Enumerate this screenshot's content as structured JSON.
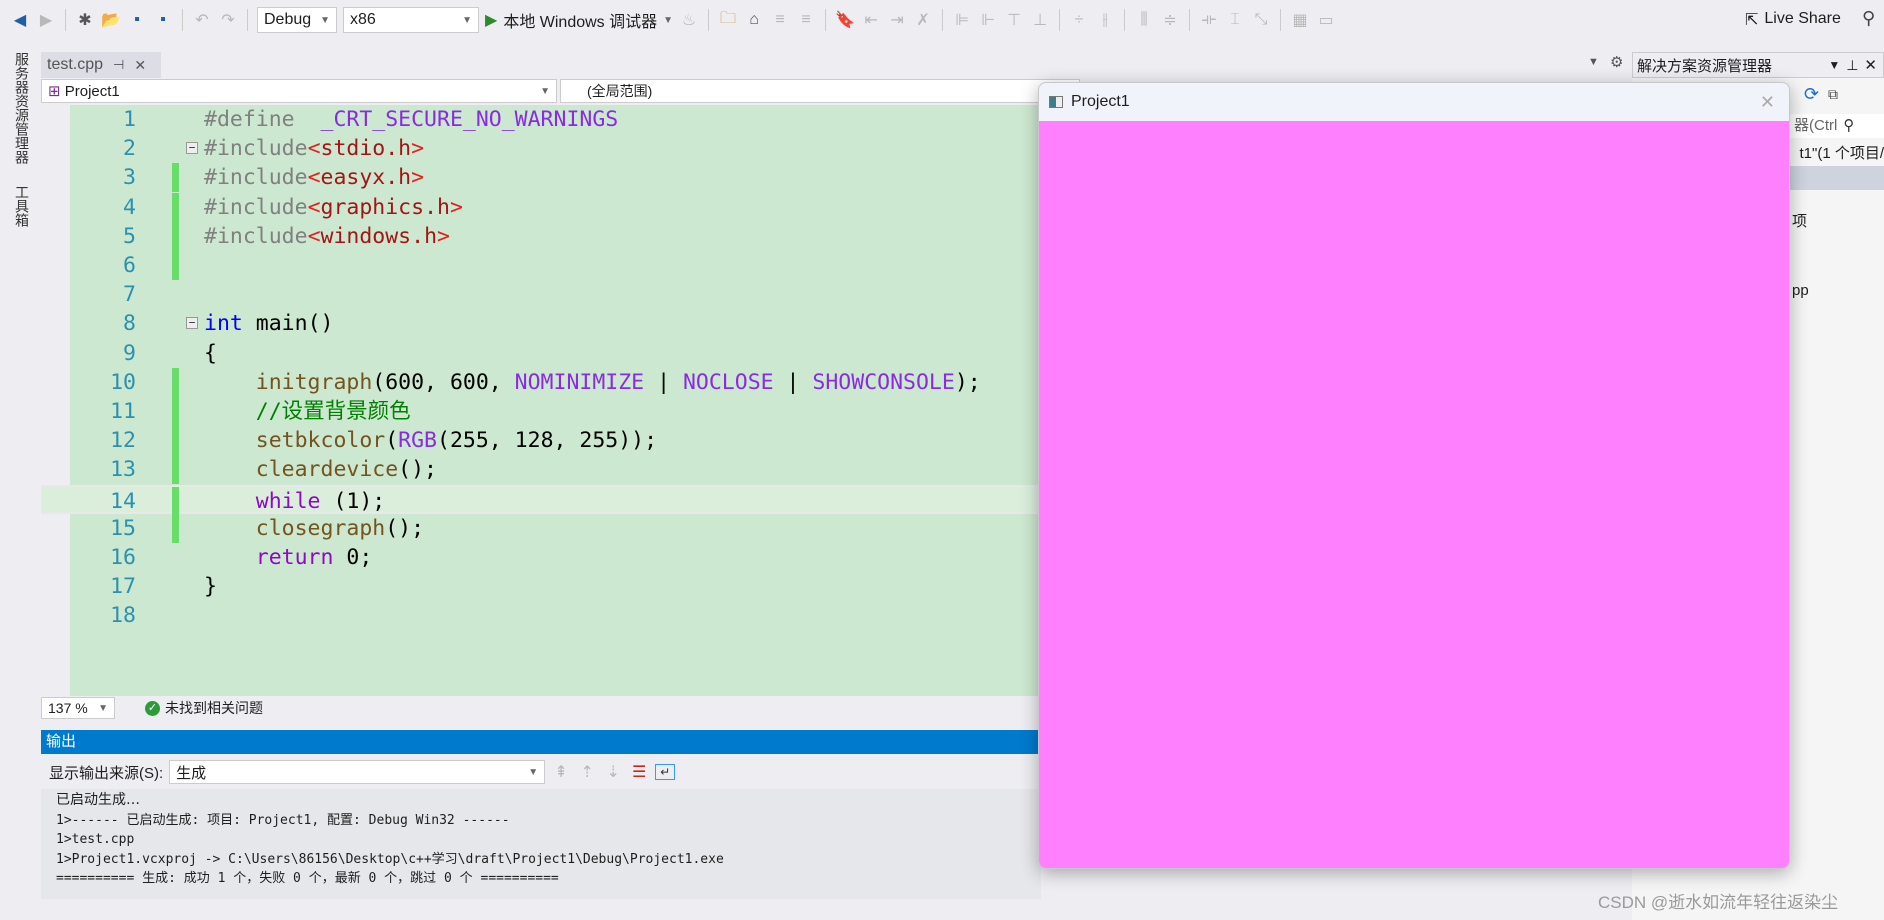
{
  "toolbar": {
    "config": "Debug",
    "platform": "x86",
    "run_label": "本地 Windows 调试器",
    "live_share": "Live Share"
  },
  "left_strip": {
    "tabs": [
      "服务器资源管理器",
      "工具箱"
    ]
  },
  "editor_tab": {
    "label": "test.cpp",
    "pin": "⊣",
    "close": "✕"
  },
  "navbar": {
    "project": "Project1",
    "scope": "(全局范围)"
  },
  "code": {
    "lines": [
      {
        "n": "1",
        "tokens": [
          [
            "#define  ",
            "pp"
          ],
          [
            "_CRT_SECURE_NO_WARNINGS",
            "mac"
          ]
        ]
      },
      {
        "n": "2",
        "fold": "−",
        "tokens": [
          [
            "#include",
            "pp"
          ],
          [
            "<",
            "br"
          ],
          [
            "stdio.h",
            "str"
          ],
          [
            ">",
            "br"
          ]
        ]
      },
      {
        "n": "3",
        "chg": true,
        "tokens": [
          [
            "#include",
            "pp"
          ],
          [
            "<",
            "br"
          ],
          [
            "easyx.h",
            "str"
          ],
          [
            ">",
            "br"
          ]
        ]
      },
      {
        "n": "4",
        "chg": true,
        "tokens": [
          [
            "#include",
            "pp"
          ],
          [
            "<",
            "br"
          ],
          [
            "graphics.h",
            "str"
          ],
          [
            ">",
            "br"
          ]
        ]
      },
      {
        "n": "5",
        "chg": true,
        "tokens": [
          [
            "#include",
            "pp"
          ],
          [
            "<",
            "br"
          ],
          [
            "windows.h",
            "str"
          ],
          [
            ">",
            "br"
          ]
        ]
      },
      {
        "n": "6",
        "chg": true,
        "tokens": []
      },
      {
        "n": "7",
        "tokens": []
      },
      {
        "n": "8",
        "fold": "−",
        "tokens": [
          [
            "int",
            "kwb"
          ],
          [
            " main()",
            "pl"
          ]
        ]
      },
      {
        "n": "9",
        "tokens": [
          [
            "{",
            "pl"
          ]
        ]
      },
      {
        "n": "10",
        "chg": true,
        "tokens": [
          [
            "    initgraph",
            "fn"
          ],
          [
            "(600, 600, ",
            "pl"
          ],
          [
            "NOMINIMIZE",
            "mac"
          ],
          [
            " | ",
            "pl"
          ],
          [
            "NOCLOSE",
            "mac"
          ],
          [
            " | ",
            "pl"
          ],
          [
            "SHOWCONSOLE",
            "mac"
          ],
          [
            ");",
            "pl"
          ]
        ]
      },
      {
        "n": "11",
        "chg": true,
        "tokens": [
          [
            "    //设置背景颜色",
            "cm"
          ]
        ]
      },
      {
        "n": "12",
        "chg": true,
        "tokens": [
          [
            "    setbkcolor",
            "fn"
          ],
          [
            "(",
            "pl"
          ],
          [
            "RGB",
            "mac"
          ],
          [
            "(255, 128, 255));",
            "pl"
          ]
        ]
      },
      {
        "n": "13",
        "chg": true,
        "tokens": [
          [
            "    cleardevice",
            "fn"
          ],
          [
            "();",
            "pl"
          ]
        ]
      },
      {
        "n": "14",
        "chg": true,
        "current": true,
        "tokens": [
          [
            "    while",
            "kw"
          ],
          [
            " (1);",
            "pl"
          ]
        ]
      },
      {
        "n": "15",
        "chg": true,
        "tokens": [
          [
            "    closegraph",
            "fn"
          ],
          [
            "();",
            "pl"
          ]
        ]
      },
      {
        "n": "16",
        "tokens": [
          [
            "    return",
            "kw"
          ],
          [
            " 0;",
            "pl"
          ]
        ]
      },
      {
        "n": "17",
        "tokens": [
          [
            "}",
            "pl"
          ]
        ]
      },
      {
        "n": "18",
        "tokens": []
      }
    ]
  },
  "status": {
    "zoom": "137 %",
    "issues": "未找到相关问题"
  },
  "output": {
    "title": "输出",
    "source_label": "显示输出来源(S):",
    "source_value": "生成",
    "lines": [
      "已启动生成…",
      "1>------ 已启动生成: 项目: Project1, 配置: Debug Win32 ------",
      "1>test.cpp",
      "1>Project1.vcxproj -> C:\\Users\\86156\\Desktop\\c++学习\\draft\\Project1\\Debug\\Project1.exe",
      "========== 生成: 成功 1 个，失败 0 个，最新 0 个，跳过 0 个 =========="
    ]
  },
  "solution_explorer": {
    "title": "解决方案资源管理器",
    "search_fragment": "器(Ctrl",
    "solution_fragment": "t1\"(1 个项目/",
    "item_fragment_1": "项",
    "item_fragment_2": "pp"
  },
  "app_window": {
    "title": "Project1",
    "close": "✕",
    "canvas_color": "#ff80ff"
  },
  "watermark": "CSDN @逝水如流年轻往返染尘"
}
